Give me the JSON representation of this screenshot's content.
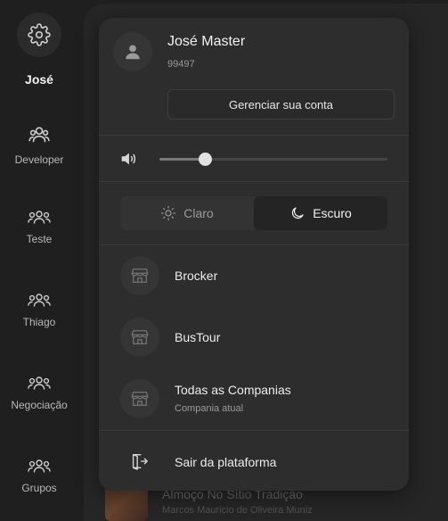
{
  "sidebar": {
    "user_label": "José",
    "items": [
      {
        "label": "Developer",
        "icon": "users-gear-icon"
      },
      {
        "label": "Teste",
        "icon": "group-icon"
      },
      {
        "label": "Thiago",
        "icon": "group-icon"
      },
      {
        "label": "Negociação",
        "icon": "group-icon"
      },
      {
        "label": "Grupos",
        "icon": "group-icon"
      }
    ]
  },
  "account_menu": {
    "user_name": "José Master",
    "user_id": "99497",
    "manage_label": "Gerenciar sua conta",
    "volume": 0.2,
    "theme": {
      "light_label": "Claro",
      "dark_label": "Escuro",
      "selected": "dark"
    },
    "companies": [
      {
        "name": "Brocker",
        "sub": ""
      },
      {
        "name": "BusTour",
        "sub": ""
      },
      {
        "name": "Todas as Companias",
        "sub": "Compania atual"
      }
    ],
    "logout_label": "Sair da plataforma"
  },
  "background": {
    "item_title": "Almoço No Sítio Tradição",
    "item_sub": "Marcos Mauricio de Oliveira Muniz"
  },
  "colors": {
    "page_bg": "#1f1f1f",
    "panel_bg": "#2d2d2d",
    "accent_text": "#f2f2f2"
  }
}
